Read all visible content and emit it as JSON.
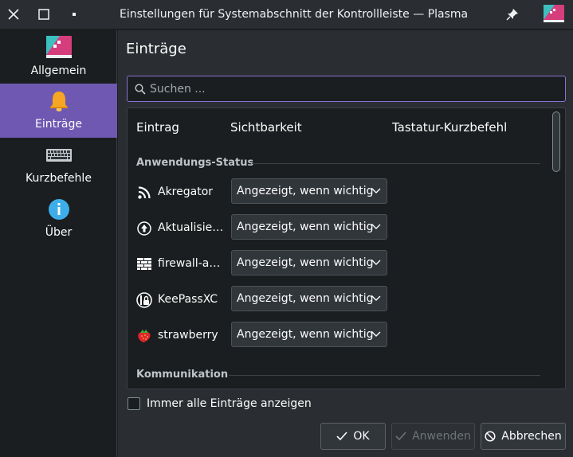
{
  "window": {
    "title": "Einstellungen für Systemabschnitt der Kontrollleiste — Plasma"
  },
  "sidebar": {
    "items": [
      {
        "label": "Allgemein",
        "icon": "general-settings-icon"
      },
      {
        "label": "Einträge",
        "icon": "bell-icon",
        "active": true
      },
      {
        "label": "Kurzbefehle",
        "icon": "keyboard-icon"
      },
      {
        "label": "Über",
        "icon": "info-icon"
      }
    ]
  },
  "main": {
    "title": "Einträge",
    "search": {
      "placeholder": "Suchen ...",
      "value": ""
    },
    "columns": [
      "Eintrag",
      "Sichtbarkeit",
      "Tastatur-Kurzbefehl"
    ],
    "groups": [
      {
        "title": "Anwendungs-Status",
        "rows": [
          {
            "name": "Akregator",
            "icon": "rss-feed-icon",
            "visibility": "Angezeigt, wenn wichtig"
          },
          {
            "name": "Aktualisierungen",
            "icon": "update-arrow-icon",
            "visibility": "Angezeigt, wenn wichtig"
          },
          {
            "name": "firewall-applet",
            "icon": "firewall-icon",
            "visibility": "Angezeigt, wenn wichtig"
          },
          {
            "name": "KeePassXC",
            "icon": "keepassxc-lock-icon",
            "visibility": "Angezeigt, wenn wichtig"
          },
          {
            "name": "strawberry",
            "icon": "strawberry-icon",
            "visibility": "Angezeigt, wenn wichtig"
          }
        ]
      },
      {
        "title": "Kommunikation",
        "rows": []
      }
    ],
    "show_all_label": "Immer alle Einträge anzeigen",
    "show_all_checked": false
  },
  "buttons": {
    "ok": "OK",
    "apply": "Anwenden",
    "cancel": "Abbrechen"
  },
  "colors": {
    "accent": "#6e58b1",
    "focus": "#8a72d6",
    "window_bg": "#2a2e32",
    "view_bg": "#1b1e20"
  }
}
